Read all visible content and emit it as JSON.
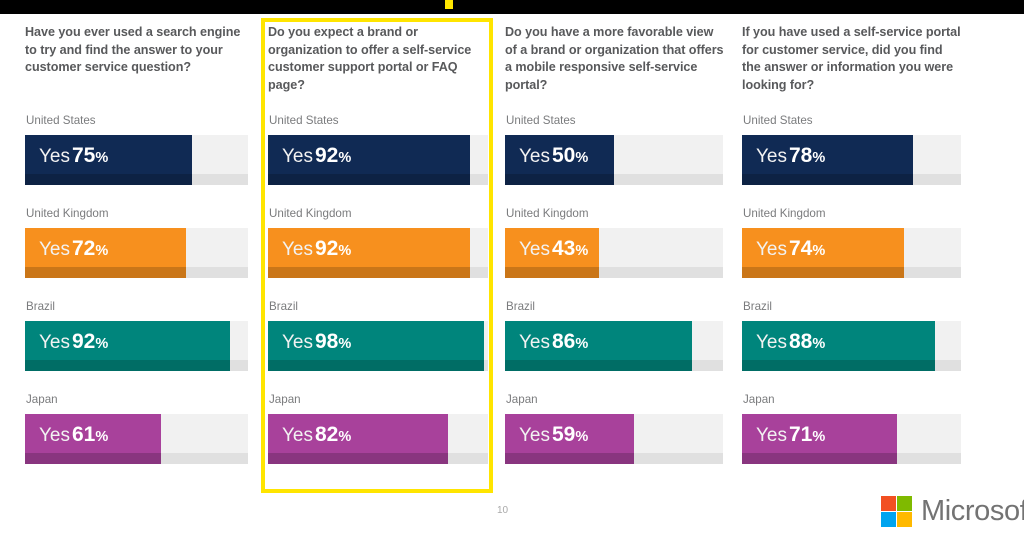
{
  "slide": {
    "page_number": "10",
    "brand": "Microsoft",
    "accent_highlight_color": "#FFE500",
    "top_band_color": "#000000",
    "top_band_tab_color": "#FFE600"
  },
  "series_colors": {
    "United States": "#102A54",
    "United Kingdom": "#F7901E",
    "Brazil": "#00857C",
    "Japan": "#A8419B"
  },
  "chart_data": {
    "type": "bar",
    "title": "",
    "xlabel": "",
    "ylabel": "",
    "xlim": [
      0,
      100
    ],
    "grid": false,
    "legend_position": "none",
    "value_prefix": "Yes ",
    "value_suffix": "%",
    "categories": [
      "United States",
      "United Kingdom",
      "Brazil",
      "Japan"
    ],
    "series": [
      {
        "name": "Have you ever used a search engine to try and find the answer to your customer service question?",
        "highlighted": false,
        "values": [
          75,
          72,
          92,
          61
        ]
      },
      {
        "name": "Do you expect a brand or organization to offer a self-service customer support portal or FAQ page?",
        "highlighted": true,
        "values": [
          92,
          92,
          98,
          82
        ]
      },
      {
        "name": "Do you have a more favorable view of a brand or organization that offers a mobile responsive self-service portal?",
        "highlighted": false,
        "values": [
          50,
          43,
          86,
          59
        ]
      },
      {
        "name": "If you have used a self-service portal for customer service, did you find the answer or information you were looking for?",
        "highlighted": false,
        "values": [
          78,
          74,
          88,
          71
        ]
      }
    ]
  },
  "columns": [
    {
      "question": "Have you ever used a search engine to try and find the answer to your customer service question?",
      "highlighted": false,
      "rows": [
        {
          "country": "United States",
          "yes_label": "Yes",
          "value": "75",
          "percent": "%",
          "pct_num": 75,
          "color": "#102A54"
        },
        {
          "country": "United Kingdom",
          "yes_label": "Yes",
          "value": "72",
          "percent": "%",
          "pct_num": 72,
          "color": "#F7901E"
        },
        {
          "country": "Brazil",
          "yes_label": "Yes",
          "value": "92",
          "percent": "%",
          "pct_num": 92,
          "color": "#00857C"
        },
        {
          "country": "Japan",
          "yes_label": "Yes",
          "value": "61",
          "percent": "%",
          "pct_num": 61,
          "color": "#A8419B"
        }
      ]
    },
    {
      "question": "Do you expect a brand or organization to offer a self-service customer support portal or FAQ page?",
      "highlighted": true,
      "rows": [
        {
          "country": "United States",
          "yes_label": "Yes",
          "value": "92",
          "percent": "%",
          "pct_num": 92,
          "color": "#102A54"
        },
        {
          "country": "United Kingdom",
          "yes_label": "Yes",
          "value": "92",
          "percent": "%",
          "pct_num": 92,
          "color": "#F7901E"
        },
        {
          "country": "Brazil",
          "yes_label": "Yes",
          "value": "98",
          "percent": "%",
          "pct_num": 98,
          "color": "#00857C"
        },
        {
          "country": "Japan",
          "yes_label": "Yes",
          "value": "82",
          "percent": "%",
          "pct_num": 82,
          "color": "#A8419B"
        }
      ]
    },
    {
      "question": "Do you have a more favorable view of a brand or organization that offers a mobile responsive self-service portal?",
      "highlighted": false,
      "rows": [
        {
          "country": "United States",
          "yes_label": "Yes",
          "value": "50",
          "percent": "%",
          "pct_num": 50,
          "color": "#102A54"
        },
        {
          "country": "United Kingdom",
          "yes_label": "Yes",
          "value": "43",
          "percent": "%",
          "pct_num": 43,
          "color": "#F7901E"
        },
        {
          "country": "Brazil",
          "yes_label": "Yes",
          "value": "86",
          "percent": "%",
          "pct_num": 86,
          "color": "#00857C"
        },
        {
          "country": "Japan",
          "yes_label": "Yes",
          "value": "59",
          "percent": "%",
          "pct_num": 59,
          "color": "#A8419B"
        }
      ]
    },
    {
      "question": "If you have used a self-service portal for customer service, did you find the answer or information you were looking for?",
      "highlighted": false,
      "rows": [
        {
          "country": "United States",
          "yes_label": "Yes",
          "value": "78",
          "percent": "%",
          "pct_num": 78,
          "color": "#102A54"
        },
        {
          "country": "United Kingdom",
          "yes_label": "Yes",
          "value": "74",
          "percent": "%",
          "pct_num": 74,
          "color": "#F7901E"
        },
        {
          "country": "Brazil",
          "yes_label": "Yes",
          "value": "88",
          "percent": "%",
          "pct_num": 88,
          "color": "#00857C"
        },
        {
          "country": "Japan",
          "yes_label": "Yes",
          "value": "71",
          "percent": "%",
          "pct_num": 71,
          "color": "#A8419B"
        }
      ]
    }
  ]
}
